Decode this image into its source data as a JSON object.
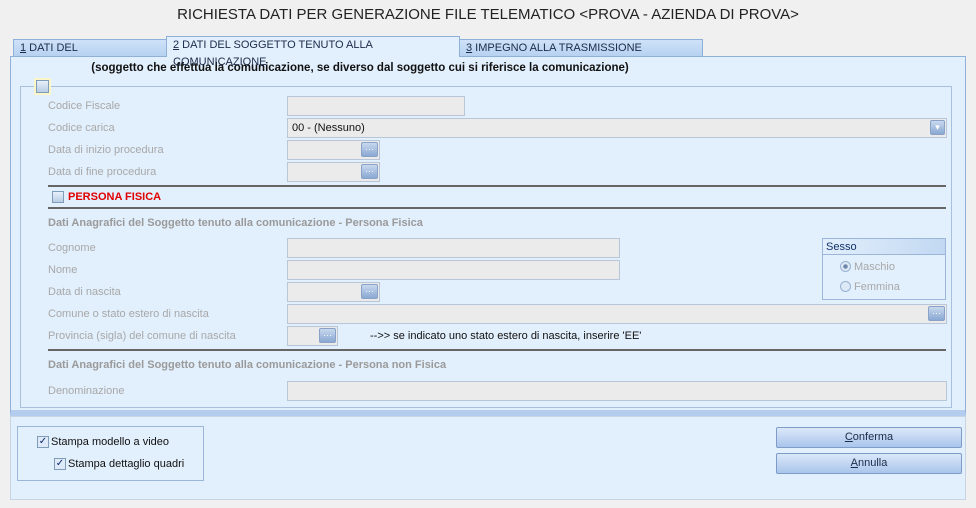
{
  "window": {
    "title": "RICHIESTA DATI PER GENERAZIONE FILE TELEMATICO <PROVA - AZIENDA DI PROVA>"
  },
  "tabs": [
    {
      "key": "1",
      "label": " DATI DEL CONTRIBUENTE"
    },
    {
      "key": "2",
      "label": " DATI DEL SOGGETTO TENUTO ALLA COMUNICAZIONE"
    },
    {
      "key": "3",
      "label": " IMPEGNO ALLA TRASMISSIONE TELEMATICA"
    }
  ],
  "note": "(soggetto che effettua la comunicazione, se diverso dal soggetto cui si riferisce la comunicazione)",
  "form": {
    "codice_fiscale": {
      "label": "Codice Fiscale",
      "value": ""
    },
    "codice_carica": {
      "label": "Codice carica",
      "value": "00 - (Nessuno)"
    },
    "data_inizio": {
      "label": "Data di inizio procedura",
      "value": ""
    },
    "data_fine": {
      "label": "Data di fine procedura",
      "value": ""
    },
    "persona_fisica": "PERSONA FISICA",
    "heading_pf": "Dati Anagrafici del Soggetto tenuto alla comunicazione - Persona Fisica",
    "cognome": "Cognome",
    "nome": "Nome",
    "data_nascita": "Data di nascita",
    "comune": "Comune o stato estero di nascita",
    "provincia": "Provincia (sigla) del comune di nascita",
    "provincia_hint": "-->> se indicato uno stato estero di nascita, inserire 'EE'",
    "heading_pnf": "Dati Anagrafici del Soggetto tenuto alla comunicazione - Persona non Fisica",
    "denominazione": "Denominazione",
    "sesso": {
      "title": "Sesso",
      "options": [
        "Maschio",
        "Femmina"
      ],
      "selected": "Maschio"
    },
    "button_glyph": "···"
  },
  "options": {
    "stampa_modello": "Stampa modello a video",
    "stampa_dettaglio": "Stampa dettaglio quadri",
    "check": "✓"
  },
  "buttons": {
    "conferma_key": "C",
    "conferma_rest": "onferma",
    "annulla_key": "A",
    "annulla_rest": "nnulla"
  }
}
